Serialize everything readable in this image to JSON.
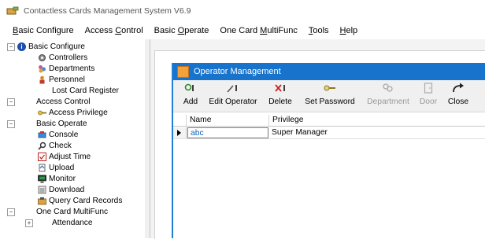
{
  "app": {
    "title": "Contactless Cards Management System  V6.9"
  },
  "menu": [
    {
      "pre": "",
      "u": "B",
      "post": "asic Configure",
      "name": "menu-basic-configure"
    },
    {
      "pre": "Access ",
      "u": "C",
      "post": "ontrol",
      "name": "menu-access-control"
    },
    {
      "pre": "Basic ",
      "u": "O",
      "post": "perate",
      "name": "menu-basic-operate"
    },
    {
      "pre": "One Card ",
      "u": "M",
      "post": "ultiFunc",
      "name": "menu-one-card-multifunc"
    },
    {
      "pre": "",
      "u": "T",
      "post": "ools",
      "name": "menu-tools"
    },
    {
      "pre": "",
      "u": "H",
      "post": "elp",
      "name": "menu-help"
    }
  ],
  "tree": {
    "basic_configure": "Basic Configure",
    "controllers": "Controllers",
    "departments": "Departments",
    "personnel": "Personnel",
    "lost_card_register": "Lost Card Register",
    "access_control": "Access Control",
    "access_privilege": "Access Privilege",
    "basic_operate": "Basic Operate",
    "console": "Console",
    "check": "Check",
    "adjust_time": "Adjust Time",
    "upload": "Upload",
    "monitor": "Monitor",
    "download": "Download",
    "query_card_records": "Query Card Records",
    "one_card_multifunc": "One Card MultiFunc",
    "attendance": "Attendance"
  },
  "operator_window": {
    "title": "Operator Management",
    "toolbar": {
      "add": "Add",
      "edit_operator": "Edit Operator",
      "delete": "Delete",
      "set_password": "Set Password",
      "department": "Department",
      "door": "Door",
      "close": "Close"
    },
    "columns": {
      "name": "Name",
      "privilege": "Privilege"
    },
    "rows": [
      {
        "name": "abc",
        "privilege": "Super Manager"
      }
    ]
  },
  "colors": {
    "title_bar": "#1873cc",
    "accent": "#1e7fd6",
    "name_cell_text": "#1060c0"
  }
}
